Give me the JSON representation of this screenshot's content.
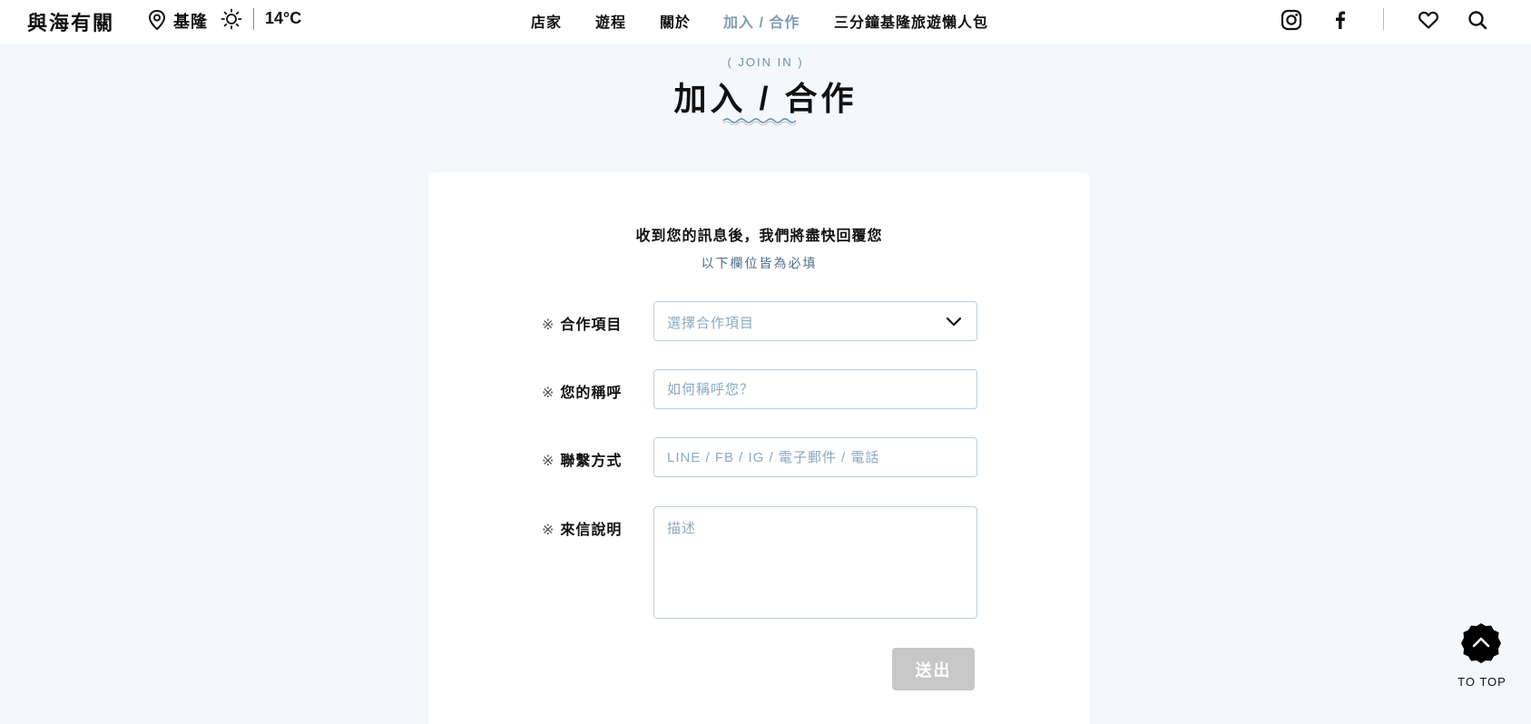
{
  "header": {
    "logo": "與海有關",
    "location_icon": "map-pin-icon",
    "city": "基隆",
    "weather_icon": "sun-icon",
    "temperature": "14°C",
    "nav": [
      {
        "label": "店家",
        "active": false
      },
      {
        "label": "遊程",
        "active": false
      },
      {
        "label": "關於",
        "active": false
      },
      {
        "label": "加入 / 合作",
        "active": true
      },
      {
        "label": "三分鐘基隆旅遊懶人包",
        "active": false
      }
    ],
    "icons": [
      "instagram-icon",
      "facebook-icon",
      "heart-icon",
      "search-icon"
    ]
  },
  "page": {
    "eyebrow": "( JOIN IN )",
    "title": "加入 / 合作"
  },
  "form": {
    "heading": "收到您的訊息後，我們將盡快回覆您",
    "subheading": "以下欄位皆為必填",
    "required_mark": "※",
    "fields": [
      {
        "label": "合作項目",
        "type": "select",
        "placeholder": "選擇合作項目"
      },
      {
        "label": "您的稱呼",
        "type": "text",
        "placeholder": "如何稱呼您？"
      },
      {
        "label": "聯繫方式",
        "type": "text",
        "placeholder": "LINE / FB / IG / 電子郵件 / 電話"
      },
      {
        "label": "來信說明",
        "type": "textarea",
        "placeholder": "描述"
      }
    ],
    "submit_label": "送出"
  },
  "to_top": {
    "label": "TO TOP",
    "icon": "chevron-up-icon"
  },
  "colors": {
    "background": "#f4f8fb",
    "accent": "#7e9db3",
    "field_border": "#b9cfdc",
    "submit_disabled": "#c7c7c7"
  }
}
